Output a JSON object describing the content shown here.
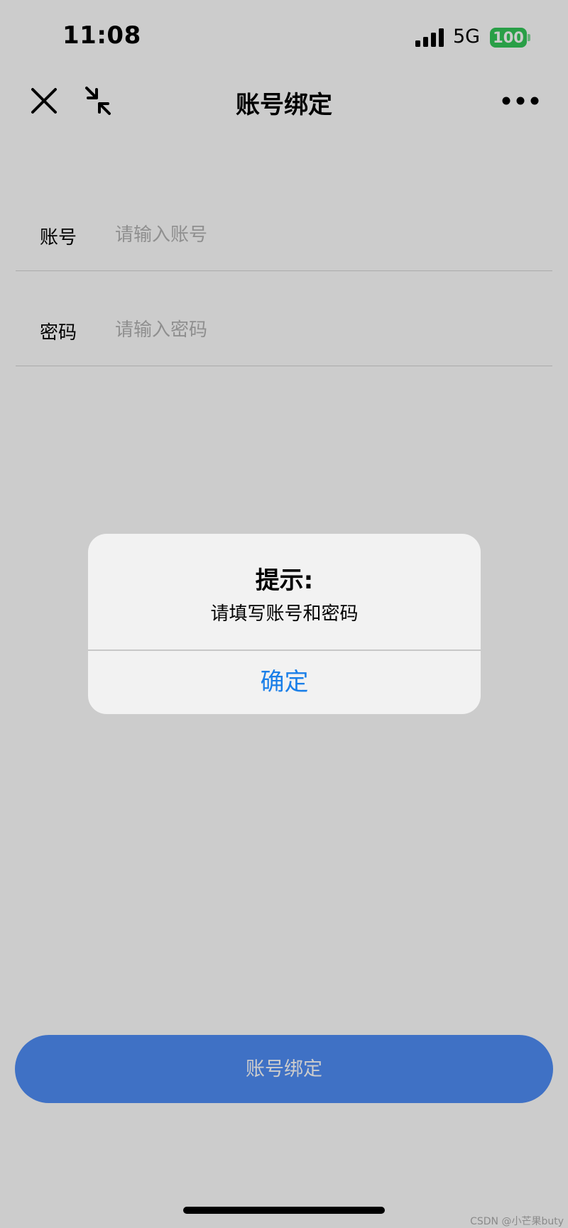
{
  "status_bar": {
    "time": "11:08",
    "network": "5G",
    "battery": "100"
  },
  "nav": {
    "title": "账号绑定"
  },
  "form": {
    "account_label": "账号",
    "account_placeholder": "请输入账号",
    "password_label": "密码",
    "password_placeholder": "请输入密码"
  },
  "bind_button_label": "账号绑定",
  "dialog": {
    "title": "提示:",
    "message": "请填写账号和密码",
    "confirm_label": "确定"
  },
  "watermark": "CSDN @小芒果buty",
  "colors": {
    "primary_button": "#4f8ef7",
    "dialog_action": "#1a7fe8",
    "battery": "#34c759"
  }
}
